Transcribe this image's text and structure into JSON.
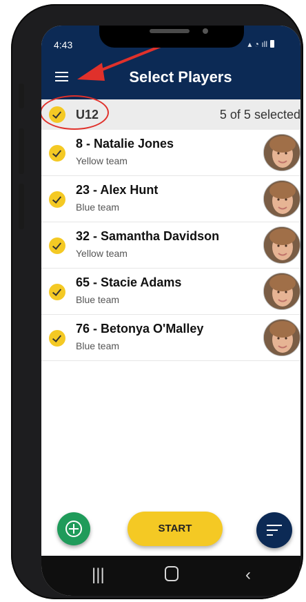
{
  "status_bar": {
    "time": "4:43"
  },
  "app_bar": {
    "title": "Select Players"
  },
  "group": {
    "name": "U12",
    "selected_count": "5 of 5 selected"
  },
  "players": [
    {
      "name": "8 - Natalie Jones",
      "team": "Yellow team",
      "selected": true
    },
    {
      "name": "23 - Alex Hunt",
      "team": "Blue team",
      "selected": true
    },
    {
      "name": "32 - Samantha Davidson",
      "team": "Yellow team",
      "selected": true
    },
    {
      "name": "65 - Stacie Adams",
      "team": "Blue team",
      "selected": true
    },
    {
      "name": "76 - Betonya O'Malley",
      "team": "Blue team",
      "selected": true
    }
  ],
  "actions": {
    "start_label": "START"
  },
  "icons": {
    "menu": "hamburger-menu-icon",
    "add": "add-circle-icon",
    "sort": "sort-icon",
    "nav_recent": "recent-apps-icon",
    "nav_home": "home-icon",
    "nav_back": "back-icon"
  },
  "colors": {
    "app_bar": "#0c2a55",
    "accent_yellow": "#f4c924",
    "add_green": "#1f9b5a",
    "annotation_red": "#e0312b"
  }
}
